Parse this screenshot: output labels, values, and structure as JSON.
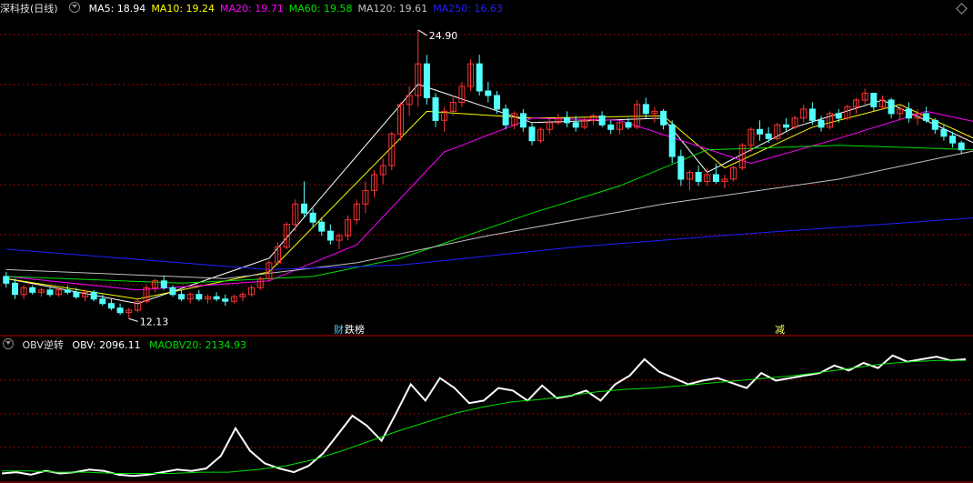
{
  "header": {
    "stock_title": "深科技(日线)",
    "ma_labels": [
      {
        "text": "MA5: 18.94",
        "color": "#ffffff"
      },
      {
        "text": "MA10: 19.24",
        "color": "#ffff00"
      },
      {
        "text": "MA20: 19.71",
        "color": "#ff00ff"
      },
      {
        "text": "MA60: 19.58",
        "color": "#00e000"
      },
      {
        "text": "MA120: 19.61",
        "color": "#c0c0c0"
      },
      {
        "text": "MA250: 16.63",
        "color": "#2020ff"
      }
    ]
  },
  "indicator_header": {
    "name": "OBV逆转",
    "obv": "OBV: 2096.11",
    "maobv": "MAOBV20: 2134.93",
    "obv_color": "#ffffff",
    "maobv_color": "#00e000"
  },
  "annotations": {
    "high_label": "24.90",
    "low_label": "12.13",
    "event1_a": "财",
    "event1_b": "跌榜",
    "event2": "减"
  },
  "colors": {
    "up": "#ff3232",
    "down": "#54ffff",
    "grid": "#a00000",
    "divider": "#c00000"
  },
  "chart_data": [
    {
      "type": "candlestick",
      "title": "深科技(日线)",
      "price_range_estimate": [
        11.5,
        25.5
      ],
      "high": 24.9,
      "low": 12.13,
      "candles_ohlc_estimate": [
        [
          14.0,
          14.2,
          13.5,
          13.7
        ],
        [
          13.7,
          13.9,
          13.0,
          13.2
        ],
        [
          13.2,
          13.6,
          13.0,
          13.5
        ],
        [
          13.5,
          13.6,
          13.2,
          13.3
        ],
        [
          13.3,
          13.5,
          13.1,
          13.4
        ],
        [
          13.4,
          13.5,
          13.1,
          13.2
        ],
        [
          13.2,
          13.5,
          13.1,
          13.4
        ],
        [
          13.4,
          13.6,
          13.2,
          13.3
        ],
        [
          13.3,
          13.5,
          13.0,
          13.1
        ],
        [
          13.1,
          13.4,
          12.9,
          13.3
        ],
        [
          13.3,
          13.4,
          12.9,
          13.0
        ],
        [
          13.0,
          13.2,
          12.7,
          12.8
        ],
        [
          12.8,
          13.0,
          12.5,
          12.6
        ],
        [
          12.6,
          12.8,
          12.3,
          12.4
        ],
        [
          12.4,
          12.6,
          12.13,
          12.5
        ],
        [
          12.5,
          13.0,
          12.4,
          12.9
        ],
        [
          12.9,
          13.6,
          12.8,
          13.5
        ],
        [
          13.5,
          13.9,
          13.3,
          13.8
        ],
        [
          13.8,
          14.0,
          13.4,
          13.5
        ],
        [
          13.5,
          13.6,
          13.1,
          13.2
        ],
        [
          13.2,
          13.4,
          12.9,
          13.0
        ],
        [
          13.0,
          13.3,
          12.8,
          13.2
        ],
        [
          13.2,
          13.4,
          12.9,
          13.0
        ],
        [
          13.0,
          13.2,
          12.8,
          13.1
        ],
        [
          13.1,
          13.3,
          12.9,
          13.0
        ],
        [
          13.0,
          13.2,
          12.7,
          12.9
        ],
        [
          12.9,
          13.2,
          12.8,
          13.1
        ],
        [
          13.1,
          13.3,
          12.9,
          13.2
        ],
        [
          13.2,
          13.6,
          13.1,
          13.5
        ],
        [
          13.5,
          14.0,
          13.4,
          13.9
        ],
        [
          13.9,
          14.7,
          13.8,
          14.6
        ],
        [
          14.6,
          15.5,
          14.5,
          15.3
        ],
        [
          15.3,
          16.4,
          15.2,
          16.3
        ],
        [
          16.3,
          17.4,
          16.0,
          17.2
        ],
        [
          17.2,
          18.2,
          16.6,
          16.8
        ],
        [
          16.8,
          17.0,
          16.2,
          16.4
        ],
        [
          16.4,
          16.6,
          15.8,
          16.0
        ],
        [
          16.0,
          16.3,
          15.4,
          15.6
        ],
        [
          15.6,
          15.9,
          15.2,
          15.8
        ],
        [
          15.8,
          16.7,
          15.6,
          16.5
        ],
        [
          16.5,
          17.4,
          16.3,
          17.2
        ],
        [
          17.2,
          18.2,
          16.8,
          17.8
        ],
        [
          17.8,
          18.7,
          17.5,
          18.5
        ],
        [
          18.5,
          19.2,
          18.1,
          18.9
        ],
        [
          18.9,
          20.4,
          18.7,
          20.3
        ],
        [
          20.3,
          21.7,
          20.0,
          21.6
        ],
        [
          21.6,
          22.4,
          21.1,
          22.0
        ],
        [
          22.0,
          24.9,
          21.5,
          23.4
        ],
        [
          23.4,
          23.8,
          21.6,
          21.9
        ],
        [
          21.9,
          22.1,
          20.6,
          20.9
        ],
        [
          20.9,
          21.5,
          20.4,
          21.3
        ],
        [
          21.3,
          22.0,
          21.1,
          21.7
        ],
        [
          21.7,
          22.6,
          21.5,
          22.4
        ],
        [
          22.4,
          23.6,
          22.2,
          23.4
        ],
        [
          23.4,
          23.8,
          22.0,
          22.2
        ],
        [
          22.2,
          22.6,
          21.7,
          22.0
        ],
        [
          22.0,
          22.2,
          21.2,
          21.4
        ],
        [
          21.4,
          21.6,
          20.5,
          20.7
        ],
        [
          20.7,
          21.3,
          20.5,
          21.2
        ],
        [
          21.2,
          21.4,
          20.4,
          20.6
        ],
        [
          20.6,
          20.8,
          19.8,
          20.0
        ],
        [
          20.0,
          20.6,
          19.9,
          20.5
        ],
        [
          20.5,
          21.0,
          20.3,
          20.8
        ],
        [
          20.8,
          21.2,
          20.7,
          21.0
        ],
        [
          21.0,
          21.3,
          20.6,
          20.8
        ],
        [
          20.8,
          21.1,
          20.4,
          20.6
        ],
        [
          20.6,
          21.0,
          20.5,
          20.9
        ],
        [
          20.9,
          21.2,
          20.7,
          21.1
        ],
        [
          21.1,
          21.3,
          20.6,
          20.7
        ],
        [
          20.7,
          20.9,
          20.3,
          20.5
        ],
        [
          20.5,
          20.9,
          20.3,
          20.8
        ],
        [
          20.8,
          21.0,
          20.5,
          20.6
        ],
        [
          20.6,
          21.8,
          20.5,
          21.6
        ],
        [
          21.6,
          21.9,
          21.0,
          21.2
        ],
        [
          21.2,
          21.5,
          20.8,
          21.3
        ],
        [
          21.3,
          21.4,
          20.5,
          20.7
        ],
        [
          20.7,
          20.9,
          19.0,
          19.3
        ],
        [
          19.3,
          19.6,
          18.0,
          18.3
        ],
        [
          18.3,
          18.7,
          17.8,
          18.6
        ],
        [
          18.6,
          18.9,
          18.0,
          18.2
        ],
        [
          18.2,
          18.8,
          18.0,
          18.5
        ],
        [
          18.5,
          19.0,
          18.1,
          18.2
        ],
        [
          18.2,
          18.5,
          17.9,
          18.3
        ],
        [
          18.3,
          18.9,
          18.2,
          18.8
        ],
        [
          18.8,
          19.9,
          18.7,
          19.8
        ],
        [
          19.8,
          20.6,
          19.5,
          20.5
        ],
        [
          20.5,
          20.9,
          20.0,
          20.3
        ],
        [
          20.3,
          20.6,
          19.9,
          20.1
        ],
        [
          20.1,
          20.8,
          20.0,
          20.7
        ],
        [
          20.7,
          21.0,
          20.4,
          20.6
        ],
        [
          20.6,
          21.1,
          20.5,
          21.0
        ],
        [
          21.0,
          21.6,
          20.8,
          21.4
        ],
        [
          21.4,
          21.7,
          20.7,
          20.9
        ],
        [
          20.9,
          21.1,
          20.4,
          20.6
        ],
        [
          20.6,
          21.3,
          20.5,
          21.2
        ],
        [
          21.2,
          21.4,
          20.8,
          21.0
        ],
        [
          21.0,
          21.6,
          20.9,
          21.5
        ],
        [
          21.5,
          21.9,
          21.2,
          21.8
        ],
        [
          21.8,
          22.3,
          21.6,
          22.1
        ],
        [
          22.1,
          22.1,
          21.3,
          21.5
        ],
        [
          21.5,
          22.0,
          21.4,
          21.8
        ],
        [
          21.8,
          21.9,
          21.0,
          21.2
        ],
        [
          21.2,
          21.6,
          20.9,
          21.4
        ],
        [
          21.4,
          21.7,
          20.8,
          21.0
        ],
        [
          21.0,
          21.4,
          20.7,
          21.2
        ],
        [
          21.2,
          21.5,
          20.8,
          20.9
        ],
        [
          20.9,
          21.0,
          20.3,
          20.5
        ],
        [
          20.5,
          20.7,
          20.0,
          20.2
        ],
        [
          20.2,
          20.4,
          19.7,
          19.9
        ],
        [
          19.9,
          20.0,
          19.4,
          19.6
        ]
      ],
      "moving_averages_estimate": {
        "MA5": [
          [
            0,
            13.9
          ],
          [
            15,
            12.8
          ],
          [
            30,
            14.8
          ],
          [
            47,
            22.5
          ],
          [
            60,
            20.8
          ],
          [
            75,
            21.0
          ],
          [
            80,
            18.6
          ],
          [
            90,
            20.6
          ],
          [
            100,
            21.8
          ],
          [
            111,
            19.8
          ]
        ],
        "MA10": [
          [
            0,
            13.9
          ],
          [
            15,
            13.0
          ],
          [
            30,
            14.2
          ],
          [
            48,
            21.3
          ],
          [
            60,
            21.0
          ],
          [
            75,
            21.1
          ],
          [
            82,
            18.8
          ],
          [
            92,
            20.6
          ],
          [
            102,
            21.6
          ],
          [
            111,
            20.0
          ]
        ],
        "MA20": [
          [
            0,
            14.0
          ],
          [
            15,
            13.4
          ],
          [
            30,
            13.8
          ],
          [
            40,
            15.4
          ],
          [
            50,
            19.5
          ],
          [
            60,
            21.0
          ],
          [
            70,
            20.9
          ],
          [
            85,
            19.0
          ],
          [
            95,
            20.1
          ],
          [
            105,
            21.3
          ],
          [
            111,
            20.8
          ]
        ],
        "MA60": [
          [
            0,
            14.0
          ],
          [
            20,
            13.7
          ],
          [
            35,
            14.0
          ],
          [
            45,
            14.8
          ],
          [
            60,
            16.8
          ],
          [
            70,
            18.0
          ],
          [
            80,
            19.6
          ],
          [
            95,
            19.8
          ],
          [
            111,
            19.6
          ]
        ],
        "MA120": [
          [
            0,
            14.3
          ],
          [
            25,
            13.9
          ],
          [
            40,
            14.6
          ],
          [
            55,
            15.8
          ],
          [
            75,
            17.2
          ],
          [
            95,
            18.3
          ],
          [
            111,
            19.6
          ]
        ],
        "MA250": [
          [
            0,
            15.2
          ],
          [
            30,
            14.3
          ],
          [
            45,
            14.5
          ],
          [
            65,
            15.3
          ],
          [
            85,
            15.9
          ],
          [
            111,
            16.6
          ]
        ]
      }
    },
    {
      "type": "line",
      "title": "OBV逆转",
      "series": [
        {
          "name": "OBV",
          "values": [
            0.04,
            0.05,
            0.03,
            0.06,
            0.04,
            0.05,
            0.07,
            0.06,
            0.03,
            0.02,
            0.03,
            0.05,
            0.07,
            0.06,
            0.08,
            0.18,
            0.4,
            0.22,
            0.12,
            0.08,
            0.05,
            0.1,
            0.2,
            0.35,
            0.5,
            0.42,
            0.3,
            0.52,
            0.75,
            0.62,
            0.8,
            0.72,
            0.6,
            0.62,
            0.72,
            0.7,
            0.62,
            0.74,
            0.64,
            0.66,
            0.7,
            0.62,
            0.75,
            0.82,
            0.95,
            0.85,
            0.8,
            0.75,
            0.78,
            0.8,
            0.76,
            0.72,
            0.84,
            0.78,
            0.8,
            0.82,
            0.84,
            0.9,
            0.86,
            0.92,
            0.88,
            0.98,
            0.93,
            0.95,
            0.97,
            0.94,
            0.95
          ]
        },
        {
          "name": "MAOBV20",
          "values": [
            0.06,
            0.06,
            0.05,
            0.05,
            0.04,
            0.04,
            0.04,
            0.05,
            0.05,
            0.07,
            0.1,
            0.15,
            0.22,
            0.3,
            0.38,
            0.45,
            0.52,
            0.57,
            0.61,
            0.63,
            0.66,
            0.69,
            0.71,
            0.72,
            0.74,
            0.76,
            0.78,
            0.8,
            0.82,
            0.85,
            0.88,
            0.91,
            0.93,
            0.94,
            0.94
          ]
        }
      ]
    }
  ]
}
